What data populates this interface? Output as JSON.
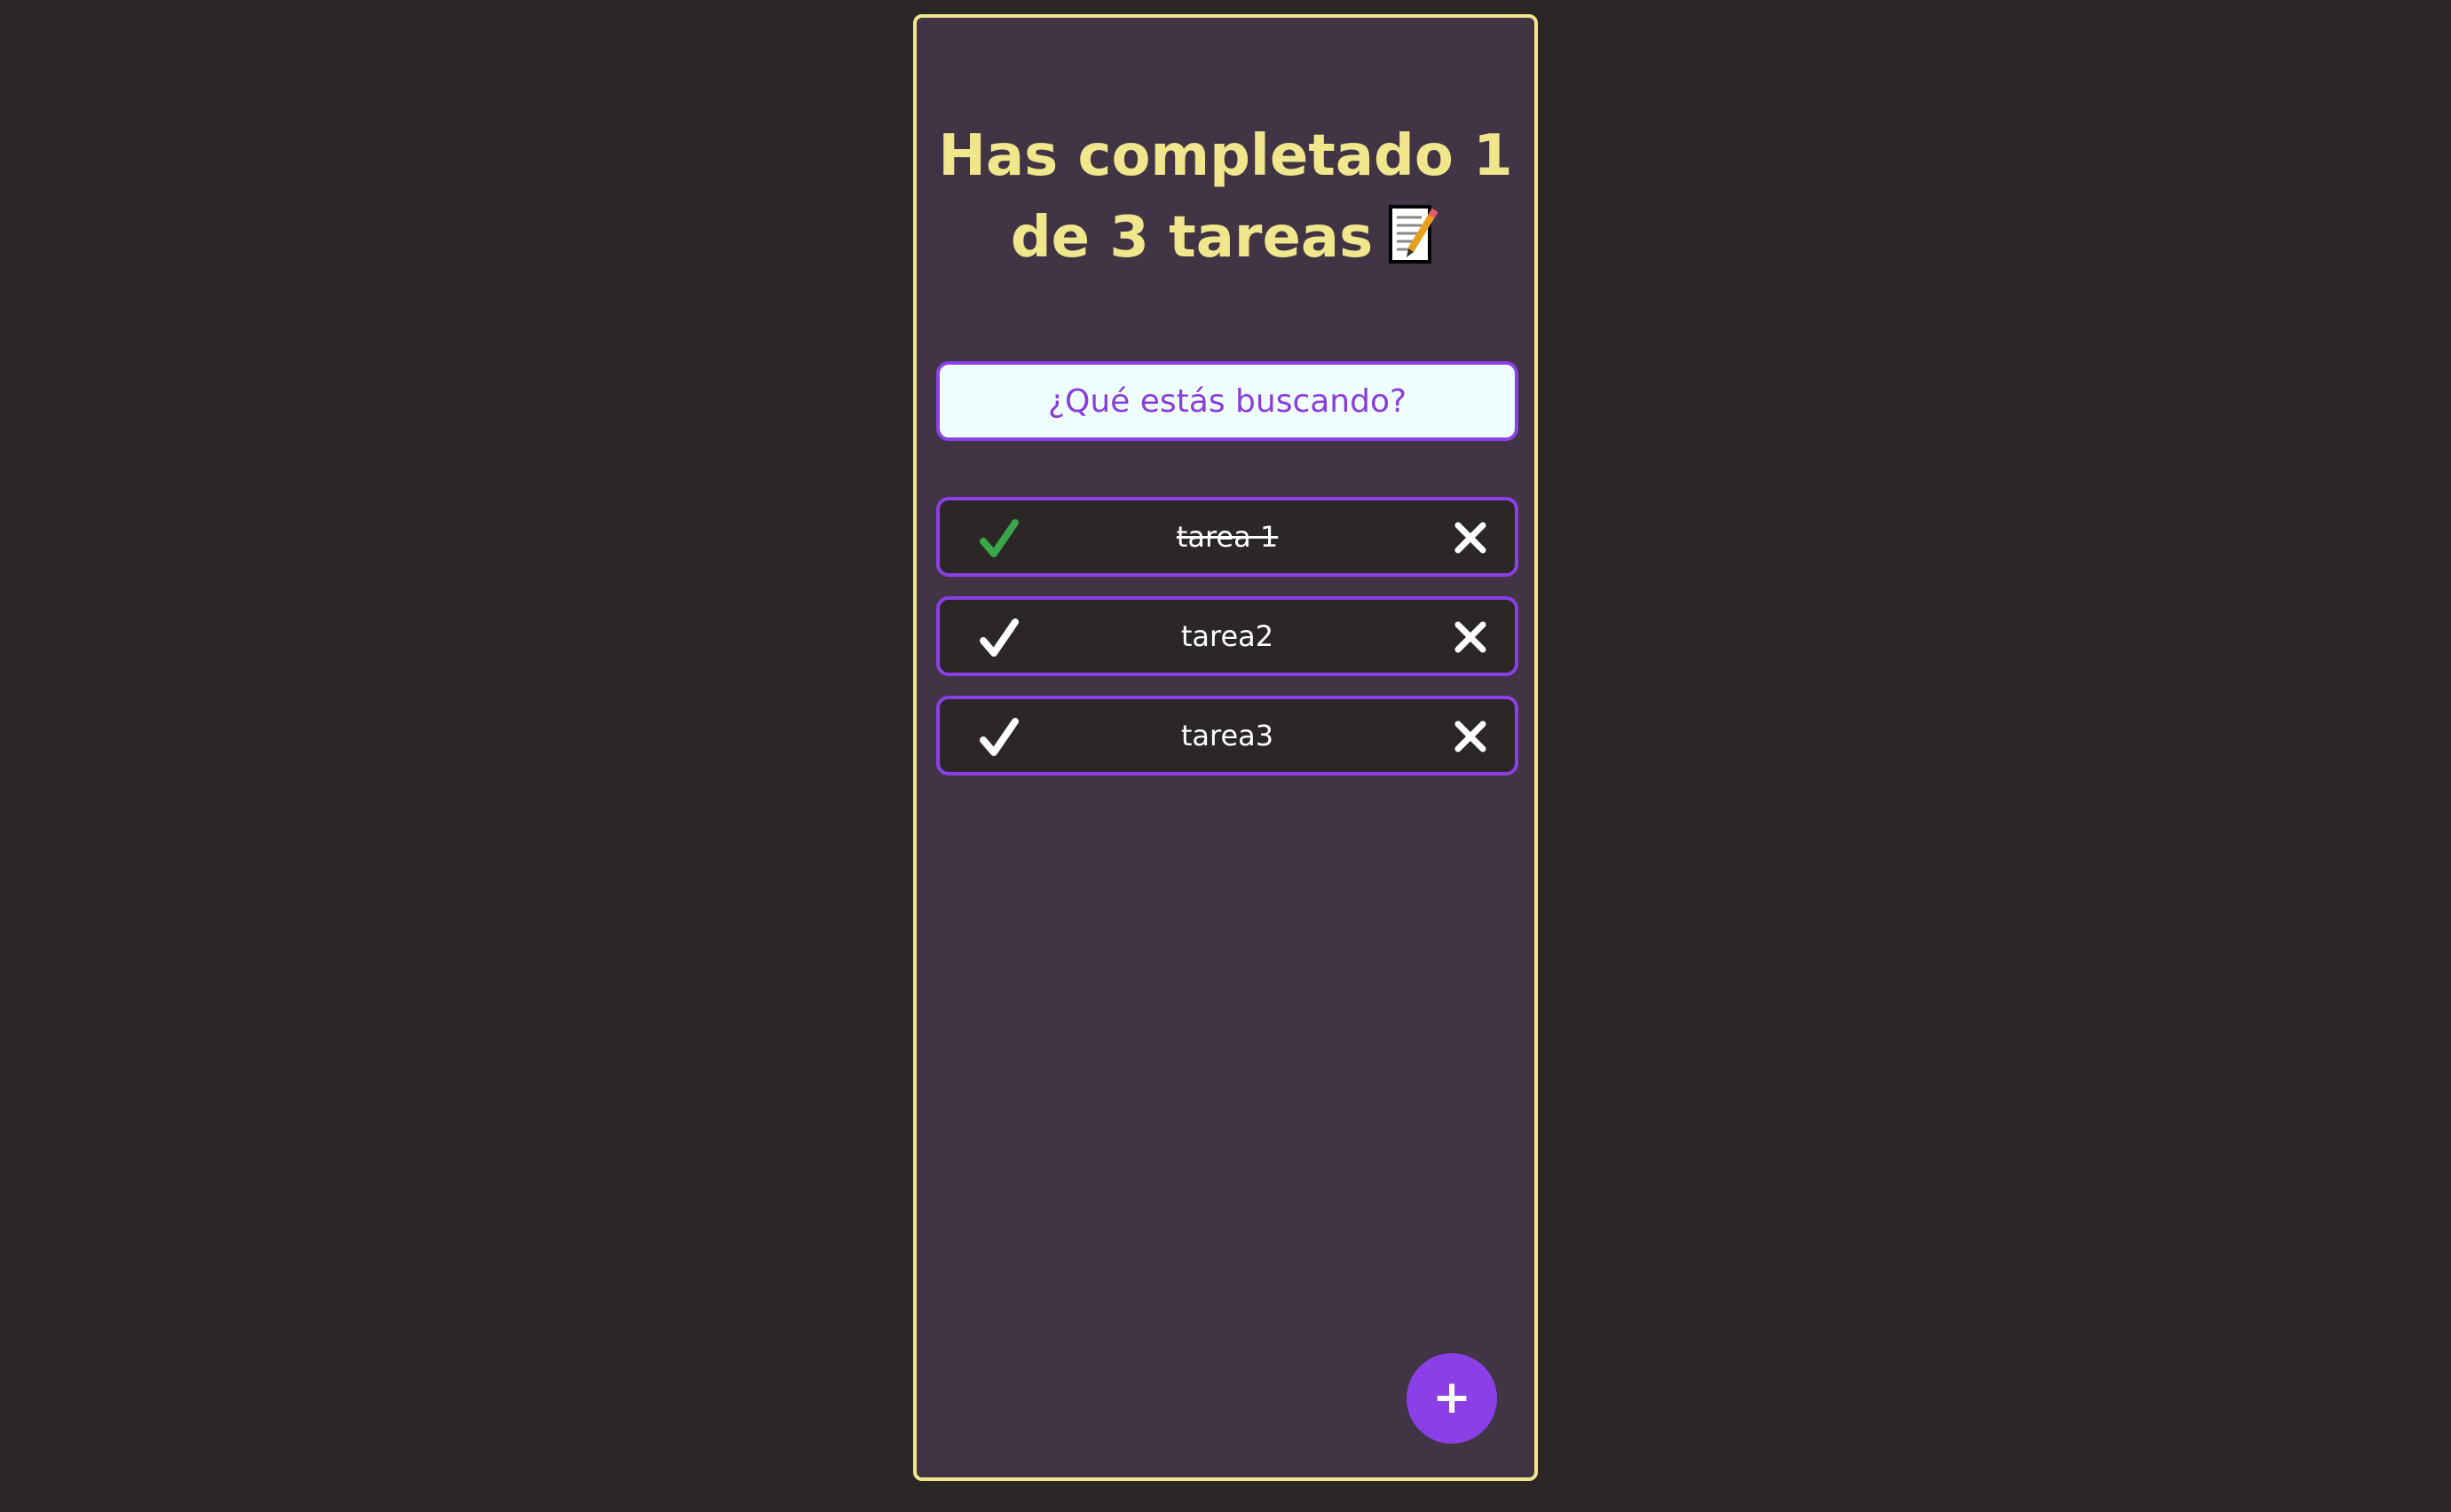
{
  "header": {
    "title_line1": "Has completado 1",
    "title_line2": "de 3 tareas",
    "title_icon": "memo-pencil-icon"
  },
  "search": {
    "placeholder": "¿Qué estás buscando?",
    "value": ""
  },
  "todos": [
    {
      "label": "tarea 1",
      "completed": true
    },
    {
      "label": "tarea2",
      "completed": false
    },
    {
      "label": "tarea3",
      "completed": false
    }
  ],
  "actions": {
    "add_label": "+"
  },
  "colors": {
    "background": "#2c2727",
    "panel": "#403445",
    "accent_yellow": "#f0e68c",
    "accent_purple": "#8a40e6",
    "check_done": "#3aa84a",
    "check_pending": "#ffffff"
  }
}
